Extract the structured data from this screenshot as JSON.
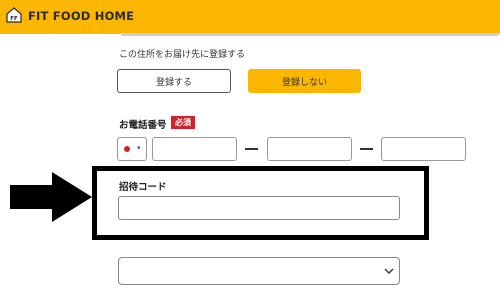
{
  "header": {
    "logo_mark": "FF",
    "brand": "FIT FOOD HOME",
    "bg_color": "#fbb600"
  },
  "address_register": {
    "question": "この住所をお届け先に登録する",
    "register_label": "登録する",
    "no_register_label": "登録しない"
  },
  "phone": {
    "label": "お電話番号",
    "required_badge": "必須",
    "country_icon": "japan-flag-icon",
    "part1": "",
    "part2": "",
    "part3": ""
  },
  "invite": {
    "label": "招待コード",
    "value": ""
  },
  "source": {
    "select_value": "",
    "chevron_icon": "chevron-down-icon"
  },
  "annotation": {
    "arrow_icon": "right-arrow-icon",
    "highlight_color": "#000000"
  }
}
